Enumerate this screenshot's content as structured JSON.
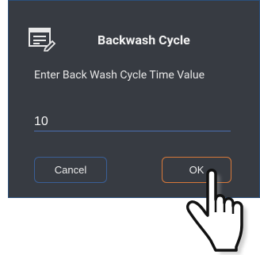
{
  "dialog": {
    "title": "Backwash Cycle",
    "icon": "edit-list-icon",
    "prompt": "Enter Back Wash Cycle Time Value",
    "input": {
      "value": "10"
    },
    "buttons": {
      "cancel_label": "Cancel",
      "ok_label": "OK"
    }
  },
  "overlay": {
    "pointer": "hand-pointer-icon"
  },
  "colors": {
    "dialog_background": "#373b42",
    "dialog_border": "#2b4f7a",
    "input_underline": "#4a6eb0",
    "cancel_border": "#3a5f97",
    "ok_border": "#d9793a",
    "text": "#f2f2f2"
  }
}
